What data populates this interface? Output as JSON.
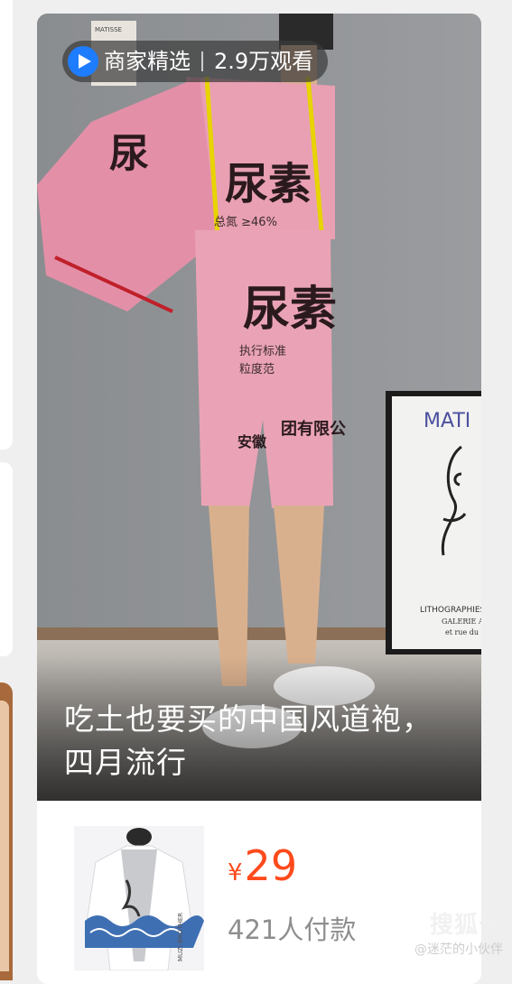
{
  "feed_card": {
    "badge": {
      "label": "商家精选",
      "views": "2.9万观看"
    },
    "caption": "吃土也要买的中国风道袍，四月流行",
    "product": {
      "currency": "¥",
      "price": "29",
      "paid_count": "421人付款"
    }
  },
  "colors": {
    "price": "#ff4a1c",
    "badge_play": "#1e7cff",
    "garment_pink": "#e9a0b3"
  },
  "icons": {
    "badge": "play-circle-icon"
  },
  "photo_text": {
    "poster_title": "MATI",
    "poster_sub1": "LITHOGRAPHIES",
    "poster_sub2": "GALERIE AI",
    "poster_sub3": "et rue du",
    "fabric_big1": "尿素",
    "fabric_big2": "尿",
    "fabric_company": "安徽",
    "fabric_company2": "团有限公",
    "fabric_line1": "总氮 ≥46%",
    "fabric_line2": "执行标准",
    "fabric_line3": "粒度范",
    "thumb_text": "MUZI BROTHER",
    "wall_tag": "MATISSE"
  },
  "watermark": {
    "line1": "搜狐号",
    "line2": "@迷茫的小伙伴"
  }
}
